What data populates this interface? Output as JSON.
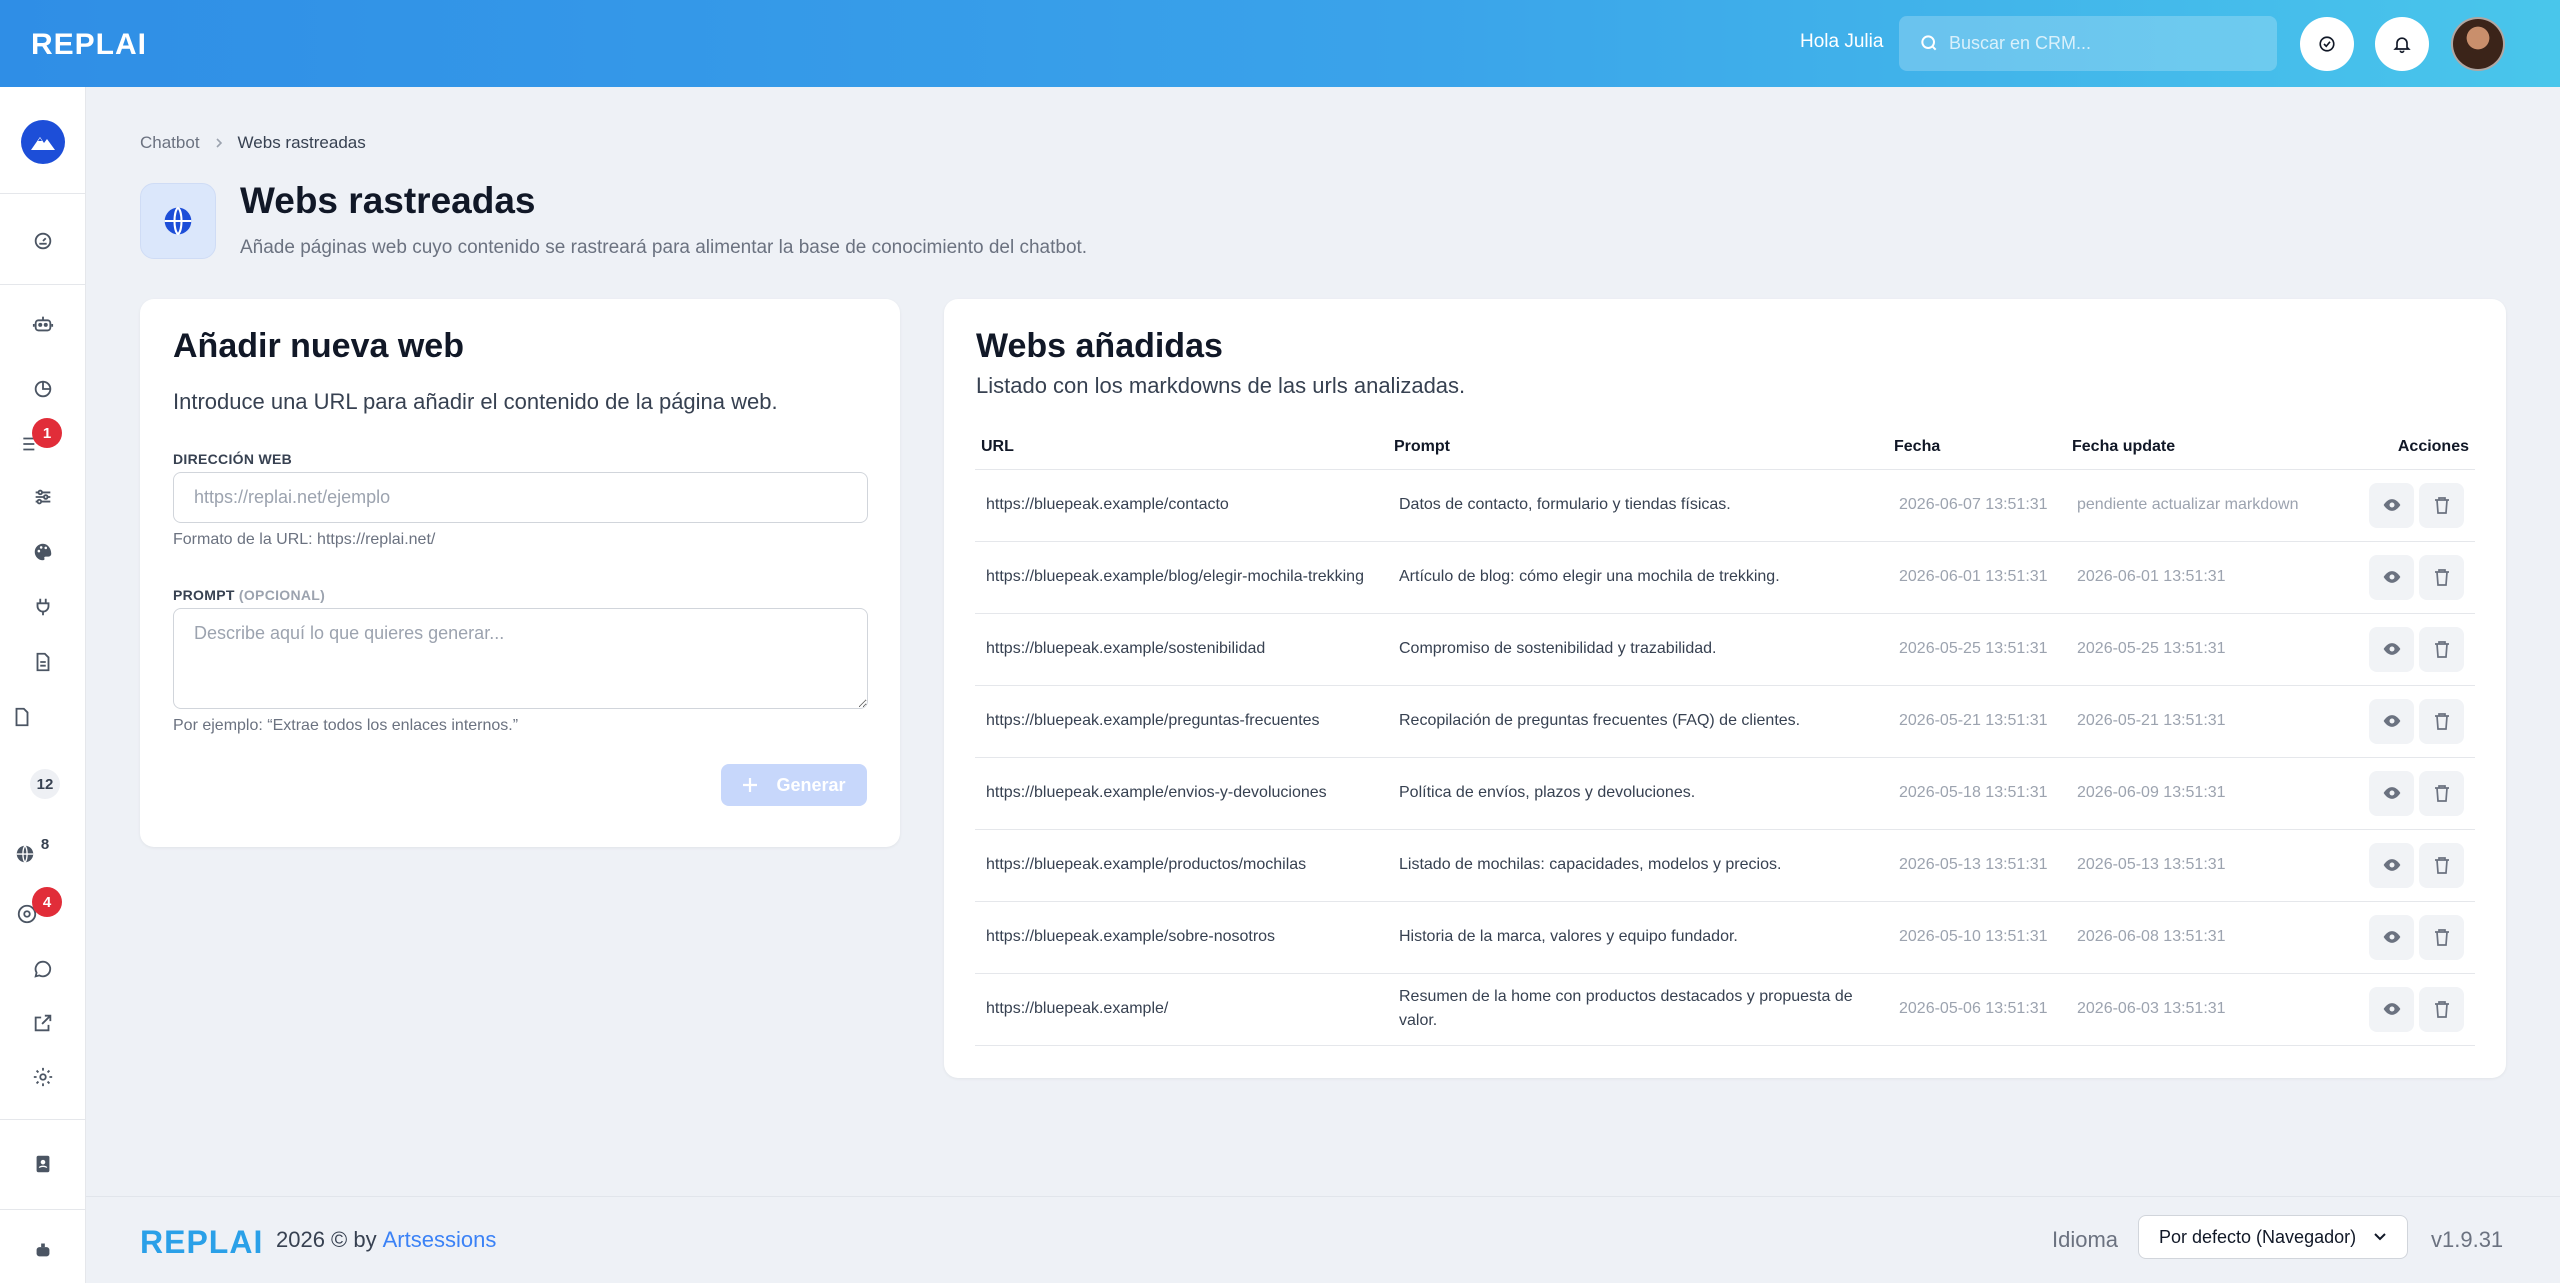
{
  "topbar": {
    "logo": "REPLAI",
    "greeting": "Hola Julia",
    "search_placeholder": "Buscar en CRM..."
  },
  "sidebar": {
    "badges": {
      "list": "1",
      "file": "12",
      "globe": "8",
      "apps": "4"
    }
  },
  "breadcrumb": {
    "parent": "Chatbot",
    "current": "Webs rastreadas"
  },
  "page": {
    "title": "Webs rastreadas",
    "subtitle": "Añade páginas web cuyo contenido se rastreará para alimentar la base de conocimiento del chatbot."
  },
  "form": {
    "title": "Añadir nueva web",
    "description": "Introduce una URL para añadir el contenido de la página web.",
    "url_label": "DIRECCIÓN WEB",
    "url_placeholder": "https://replai.net/ejemplo",
    "url_hint": "Formato de la URL: https://replai.net/",
    "prompt_label": "PROMPT",
    "prompt_optional": "(OPCIONAL)",
    "prompt_placeholder": "Describe aquí lo que quieres generar...",
    "prompt_hint": "Por ejemplo: “Extrae todos los enlaces internos.”",
    "generate_label": "Generar"
  },
  "list": {
    "title": "Webs añadidas",
    "description": "Listado con los markdowns de las urls analizadas.",
    "columns": [
      "URL",
      "Prompt",
      "Fecha",
      "Fecha update",
      "Acciones"
    ],
    "rows": [
      {
        "url": "https://bluepeak.example/contacto",
        "prompt": "Datos de contacto, formulario y tiendas físicas.",
        "fecha": "2026-06-07 13:51:31",
        "update": "pendiente actualizar markdown"
      },
      {
        "url": "https://bluepeak.example/blog/elegir-mochila-trekking",
        "prompt": "Artículo de blog: cómo elegir una mochila de trekking.",
        "fecha": "2026-06-01 13:51:31",
        "update": "2026-06-01 13:51:31"
      },
      {
        "url": "https://bluepeak.example/sostenibilidad",
        "prompt": "Compromiso de sostenibilidad y trazabilidad.",
        "fecha": "2026-05-25 13:51:31",
        "update": "2026-05-25 13:51:31"
      },
      {
        "url": "https://bluepeak.example/preguntas-frecuentes",
        "prompt": "Recopilación de preguntas frecuentes (FAQ) de clientes.",
        "fecha": "2026-05-21 13:51:31",
        "update": "2026-05-21 13:51:31"
      },
      {
        "url": "https://bluepeak.example/envios-y-devoluciones",
        "prompt": "Política de envíos, plazos y devoluciones.",
        "fecha": "2026-05-18 13:51:31",
        "update": "2026-06-09 13:51:31"
      },
      {
        "url": "https://bluepeak.example/productos/mochilas",
        "prompt": "Listado de mochilas: capacidades, modelos y precios.",
        "fecha": "2026-05-13 13:51:31",
        "update": "2026-05-13 13:51:31"
      },
      {
        "url": "https://bluepeak.example/sobre-nosotros",
        "prompt": "Historia de la marca, valores y equipo fundador.",
        "fecha": "2026-05-10 13:51:31",
        "update": "2026-06-08 13:51:31"
      },
      {
        "url": "https://bluepeak.example/",
        "prompt": "Resumen de la home con productos destacados y propuesta de valor.",
        "fecha": "2026-05-06 13:51:31",
        "update": "2026-06-03 13:51:31"
      }
    ]
  },
  "footer": {
    "logo": "REPLAI",
    "copyright": "2026 © by",
    "company": "Artsessions",
    "language_label": "Idioma",
    "language_value": "Por defecto (Navegador)",
    "version": "v1.9.31"
  },
  "colors": {
    "accent": "#2f8ee6",
    "badge_red": "#e12d39",
    "button_disabled": "#c7d7fb"
  }
}
